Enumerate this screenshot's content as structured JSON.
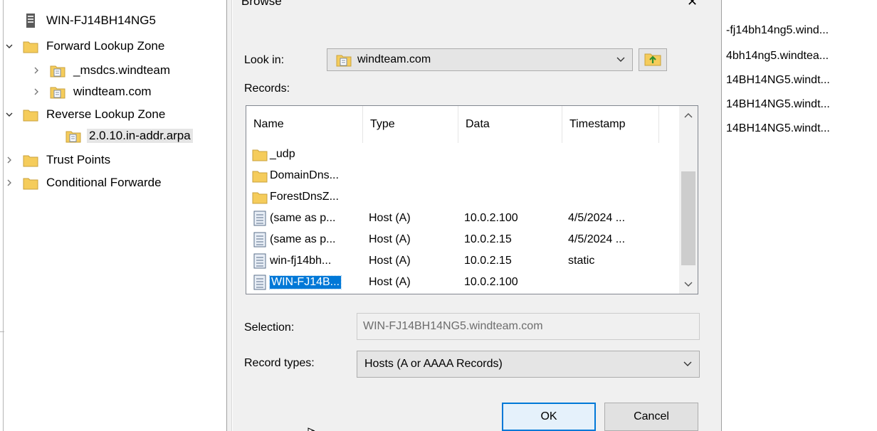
{
  "tree": {
    "server": "WIN-FJ14BH14NG5",
    "items": [
      {
        "label": "Forward Lookup Zone",
        "indent": 1,
        "expander": "expanded",
        "icon": "folder"
      },
      {
        "label": "_msdcs.windteam",
        "indent": 2,
        "expander": "collapsed",
        "icon": "zone"
      },
      {
        "label": "windteam.com",
        "indent": 2,
        "expander": "collapsed",
        "icon": "zone"
      },
      {
        "label": "Reverse Lookup Zone",
        "indent": 1,
        "expander": "expanded",
        "icon": "folder"
      },
      {
        "label": "2.0.10.in-addr.arpa",
        "indent": 3,
        "expander": "none",
        "icon": "zone",
        "selected": true
      },
      {
        "label": "Trust Points",
        "indent": 1,
        "expander": "collapsed",
        "icon": "folder"
      },
      {
        "label": "Conditional Forwarde",
        "indent": 1,
        "expander": "collapsed",
        "icon": "folder"
      }
    ]
  },
  "right_column": [
    "-fj14bh14ng5.wind...",
    "4bh14ng5.windtea...",
    "14BH14NG5.windt...",
    "14BH14NG5.windt...",
    "14BH14NG5.windt..."
  ],
  "dialog": {
    "title": "Browse",
    "close_glyph": "✕",
    "look_in_label": "Look in:",
    "look_in_value": "windteam.com",
    "records_label": "Records:",
    "columns": [
      "Name",
      "Type",
      "Data",
      "Timestamp"
    ],
    "records": [
      {
        "icon": "folder",
        "name": "_udp",
        "type": "",
        "data": "",
        "timestamp": ""
      },
      {
        "icon": "folder",
        "name": "DomainDns...",
        "type": "",
        "data": "",
        "timestamp": ""
      },
      {
        "icon": "folder",
        "name": "ForestDnsZ...",
        "type": "",
        "data": "",
        "timestamp": ""
      },
      {
        "icon": "record",
        "name": "(same as p...",
        "type": "Host (A)",
        "data": "10.0.2.100",
        "timestamp": "4/5/2024 ..."
      },
      {
        "icon": "record",
        "name": "(same as p...",
        "type": "Host (A)",
        "data": "10.0.2.15",
        "timestamp": "4/5/2024 ..."
      },
      {
        "icon": "record",
        "name": "win-fj14bh...",
        "type": "Host (A)",
        "data": "10.0.2.15",
        "timestamp": "static"
      },
      {
        "icon": "record",
        "name": "WIN-FJ14B...",
        "type": "Host (A)",
        "data": "10.0.2.100",
        "timestamp": "",
        "selected": true
      }
    ],
    "selection_label": "Selection:",
    "selection_value": "WIN-FJ14BH14NG5.windteam.com",
    "record_types_label": "Record types:",
    "record_types_value": "Hosts (A or AAAA Records)",
    "ok_label": "OK",
    "cancel_label": "Cancel"
  },
  "colors": {
    "selection": "#0078d7",
    "dialog_bg": "#f0f0f0",
    "folder": "#f5cc5b"
  }
}
